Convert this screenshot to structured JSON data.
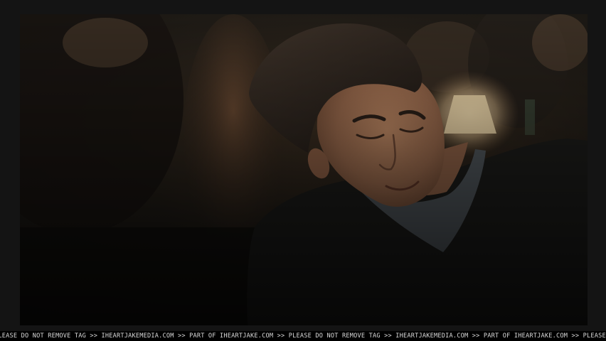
{
  "watermark": {
    "text": "PLEASE DO NOT REMOVE TAG >> IHEARTJAKEMEDIA.COM >> PART OF IHEARTJAKE.COM >> PLEASE DO NOT REMOVE TAG >> IHEARTJAKEMEDIA.COM >> PART OF IHEARTJAKE.COM >> PLEASE DO NOT REMOVE TAG >> IHEARTJAKEMEDIA.COM"
  },
  "colors": {
    "letterbox": "#141414",
    "background_warm": "#3a2d20",
    "sweater": "#1a1a18",
    "shirt": "#4d5358",
    "skin": "#a0704f",
    "hair": "#2b231d",
    "lamp_glow": "#e8d4ab"
  }
}
